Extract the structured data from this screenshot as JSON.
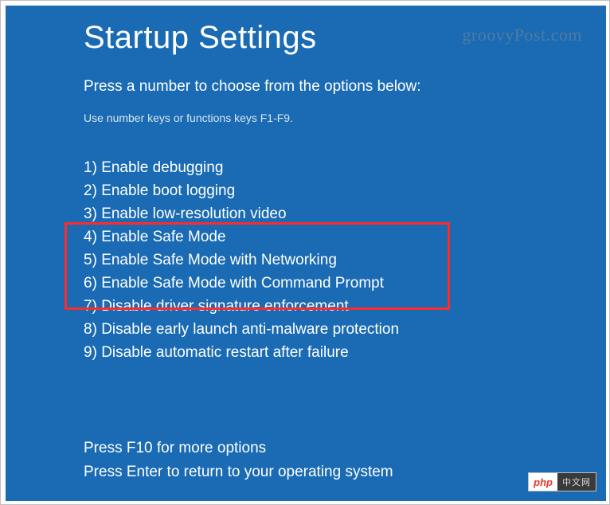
{
  "title": "Startup Settings",
  "subtitle": "Press a number to choose from the options below:",
  "hint": "Use number keys or functions keys F1-F9.",
  "options": [
    {
      "num": "1",
      "label": "Enable debugging"
    },
    {
      "num": "2",
      "label": "Enable boot logging"
    },
    {
      "num": "3",
      "label": "Enable low-resolution video"
    },
    {
      "num": "4",
      "label": "Enable Safe Mode"
    },
    {
      "num": "5",
      "label": "Enable Safe Mode with Networking"
    },
    {
      "num": "6",
      "label": "Enable Safe Mode with Command Prompt"
    },
    {
      "num": "7",
      "label": "Disable driver signature enforcement"
    },
    {
      "num": "8",
      "label": "Disable early launch anti-malware protection"
    },
    {
      "num": "9",
      "label": "Disable automatic restart after failure"
    }
  ],
  "footer": {
    "more": "Press F10 for more options",
    "return": "Press Enter to return to your operating system"
  },
  "watermark_top": "groovyPost.com",
  "watermark_bottom": {
    "php": "php",
    "cn": "中文网"
  }
}
